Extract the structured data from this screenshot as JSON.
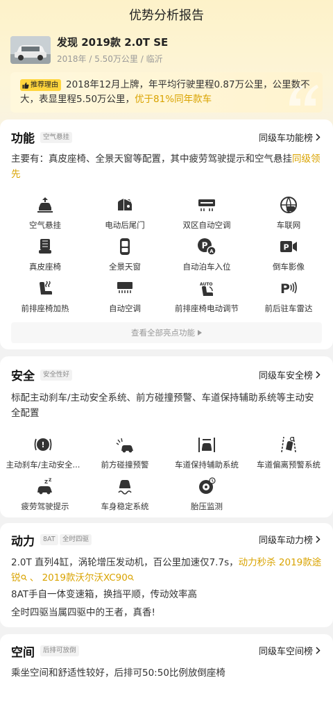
{
  "page": {
    "title": "优势分析报告"
  },
  "car": {
    "name": "发现 2019款 2.0T SE",
    "meta": "2018年 / 5.50万公里 / 临沂"
  },
  "reason": {
    "tag": "推荐理由",
    "text_plain": "2018年12月上牌，年平均行驶里程0.87万公里，公里数不大，表显里程5.50万公里，",
    "text_highlight": "优于81%同年款车"
  },
  "function": {
    "title": "功能",
    "badge": "空气悬挂",
    "rank_link": "同级车功能榜",
    "desc_plain": "主要有：真皮座椅、全景天窗等配置，其中疲劳驾驶提示和空气悬挂",
    "desc_highlight": "同级领先",
    "items": [
      {
        "label": "空气悬挂",
        "icon": "air-suspension-icon"
      },
      {
        "label": "电动后尾门",
        "icon": "power-tailgate-icon"
      },
      {
        "label": "双区自动空调",
        "icon": "dual-zone-ac-icon"
      },
      {
        "label": "车联网",
        "icon": "connected-car-icon"
      },
      {
        "label": "真皮座椅",
        "icon": "leather-seat-icon"
      },
      {
        "label": "全景天窗",
        "icon": "panoramic-sunroof-icon"
      },
      {
        "label": "自动泊车入位",
        "icon": "auto-parking-icon"
      },
      {
        "label": "倒车影像",
        "icon": "reverse-camera-icon"
      },
      {
        "label": "前排座椅加热",
        "icon": "seat-heating-icon"
      },
      {
        "label": "自动空调",
        "icon": "auto-ac-icon"
      },
      {
        "label": "前排座椅电动调节",
        "icon": "power-seat-adjust-icon"
      },
      {
        "label": "前后驻车雷达",
        "icon": "parking-radar-icon"
      }
    ],
    "view_all": "查看全部亮点功能"
  },
  "safety": {
    "title": "安全",
    "badge": "安全性好",
    "rank_link": "同级车安全榜",
    "desc": "标配主动刹车/主动安全系统、前方碰撞预警、车道保持辅助系统等主动安全配置",
    "items": [
      {
        "label": "主动刹车/主动安全...",
        "icon": "active-brake-icon"
      },
      {
        "label": "前方碰撞预警",
        "icon": "collision-warning-icon"
      },
      {
        "label": "车道保持辅助系统",
        "icon": "lane-keeping-icon"
      },
      {
        "label": "车道偏离预警系统",
        "icon": "lane-departure-icon"
      },
      {
        "label": "疲劳驾驶提示",
        "icon": "fatigue-alert-icon"
      },
      {
        "label": "车身稳定系统",
        "icon": "stability-control-icon"
      },
      {
        "label": "胎压监测",
        "icon": "tire-pressure-icon"
      }
    ]
  },
  "power": {
    "title": "动力",
    "badge1": "8AT",
    "badge2": "全时四驱",
    "rank_link": "同级车动力榜",
    "desc1_plain": "2.0T 直列4缸，涡轮增压发动机，百公里加速仅7.7s，",
    "desc1_highlight": "动力秒杀 2019款途锐",
    "desc1_sep": " 、 ",
    "desc1_highlight2": "2019款沃尔沃XC90",
    "desc2": "8AT手自一体变速箱，换挡平顺，传动效率高",
    "desc3": "全时四驱当属四驱中的王者，真香!"
  },
  "space": {
    "title": "空间",
    "badge": "后排可放倒",
    "rank_link": "同级车空间榜",
    "desc": "乘坐空间和舒适性较好，后排可50:50比例放倒座椅"
  },
  "colors": {
    "accent": "#ffd53d",
    "highlight": "#d9a300",
    "hero_bg": "#fdf2c9"
  }
}
